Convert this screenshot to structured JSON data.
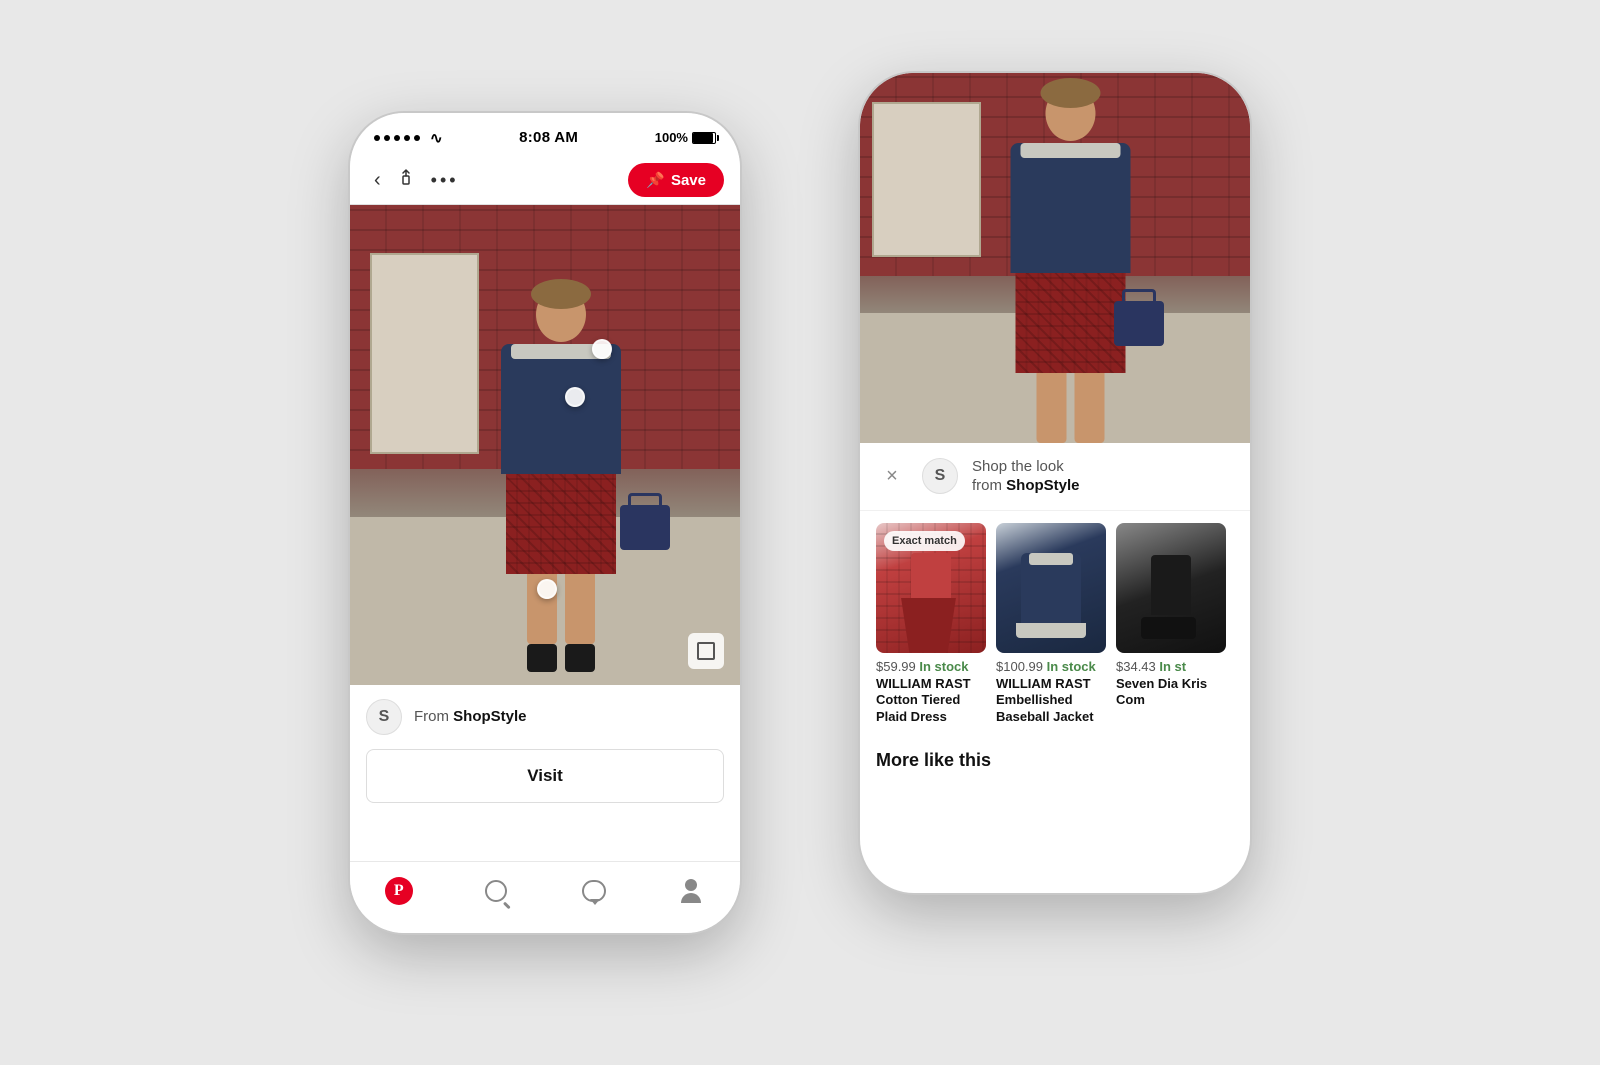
{
  "background_color": "#e8e8e8",
  "left_phone": {
    "status_bar": {
      "signal_dots": 5,
      "time": "8:08 AM",
      "battery": "100%"
    },
    "nav": {
      "back_label": "‹",
      "share_label": "↑",
      "more_label": "•••",
      "save_button": "Save"
    },
    "source": {
      "logo": "S",
      "from_text": "From",
      "shop_name": "ShopStyle"
    },
    "visit_button": "Visit",
    "bottom_nav": {
      "home_icon": "P",
      "search_icon": "search",
      "chat_icon": "chat",
      "profile_icon": "profile"
    }
  },
  "right_phone": {
    "shop_panel": {
      "close_label": "×",
      "logo": "S",
      "title_prefix": "Shop the look",
      "title_from": "from",
      "shop_name": "ShopStyle"
    },
    "products": [
      {
        "badge": "Exact match",
        "price": "$59.99",
        "stock": "In stock",
        "name": "WILLIAM RAST Cotton Tiered Plaid Dress",
        "type": "dress"
      },
      {
        "badge": null,
        "price": "$100.99",
        "stock": "In stock",
        "name": "WILLIAM RAST Embellished Baseball Jacket",
        "type": "jacket"
      },
      {
        "badge": null,
        "price": "$34.43",
        "stock": "In st",
        "name": "Seven Dia Kris Com",
        "type": "boot"
      }
    ],
    "more_section": "More like this"
  }
}
